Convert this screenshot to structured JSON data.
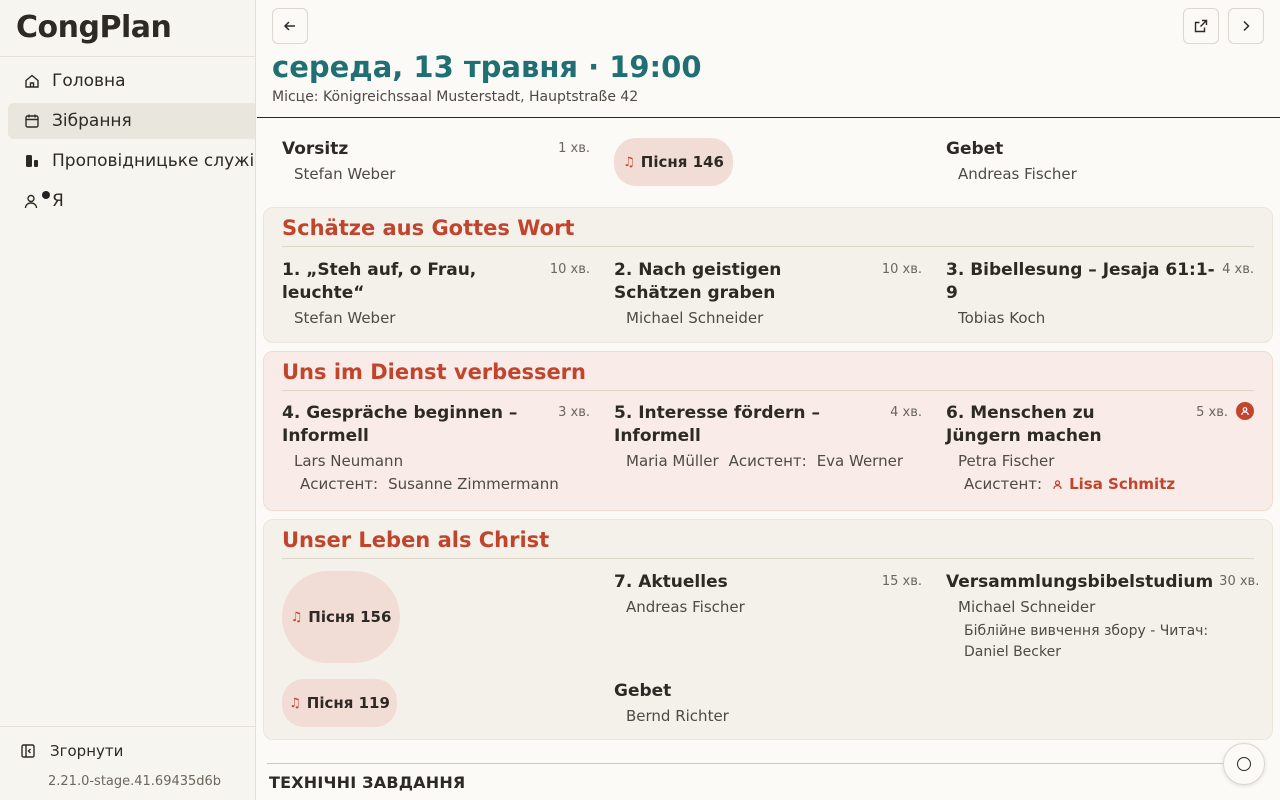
{
  "sidebar": {
    "brand": "CongPlan",
    "items": [
      {
        "label": "Головна",
        "icon": "home-icon"
      },
      {
        "label": "Зібрання",
        "icon": "calendar-icon"
      },
      {
        "label": "Проповідницьке служіння",
        "icon": "ministry-icon"
      },
      {
        "label": "Я",
        "icon": "user-icon"
      }
    ],
    "collapse_label": "Згорнути",
    "version": "2.21.0-stage.41.69435d6b"
  },
  "header": {
    "title": "середа, 13 травня · 19:00",
    "location": "Місце: Königreichssaal Musterstadt, Hauptstraße 42"
  },
  "opening": {
    "chairman": {
      "title": "Vorsitz",
      "duration": "1 хв.",
      "person": "Stefan Weber"
    },
    "song": "Пісня 146",
    "prayer": {
      "title": "Gebet",
      "person": "Andreas Fischer"
    }
  },
  "treasures": {
    "title": "Schätze aus Gottes Wort",
    "parts": [
      {
        "title": "1. „Steh auf, o Frau, leuchte“",
        "duration": "10 хв.",
        "person": "Stefan Weber"
      },
      {
        "title": "2. Nach geistigen Schätzen graben",
        "duration": "10 хв.",
        "person": "Michael Schneider"
      },
      {
        "title": "3. Bibellesung – Jesaja 61:1-9",
        "duration": "4 хв.",
        "person": "Tobias Koch"
      }
    ]
  },
  "ministry": {
    "title": "Uns im Dienst verbessern",
    "assistant_label": "Асистент:",
    "parts": [
      {
        "title": "4. Gespräche beginnen – Informell",
        "duration": "3 хв.",
        "person": "Lars Neumann",
        "assistant": "Susanne Zimmermann"
      },
      {
        "title": "5. Interesse fördern – Informell",
        "duration": "4 хв.",
        "person": "Maria Müller",
        "assistant": "Eva Werner"
      },
      {
        "title": "6. Menschen zu Jüngern machen",
        "duration": "5 хв.",
        "person": "Petra Fischer",
        "assistant": "Lisa Schmitz"
      }
    ]
  },
  "living": {
    "title": "Unser Leben als Christ",
    "song_middle": "Пісня 156",
    "song_closing": "Пісня 119",
    "parts": [
      {
        "title": "7. Aktuelles",
        "duration": "15 хв.",
        "person": "Andreas Fischer"
      },
      {
        "title": "Versammlungsbibelstudium",
        "duration": "30 хв.",
        "person": "Michael Schneider",
        "reader_note": "Біблійне вивчення збору - Читач: Daniel Becker"
      }
    ],
    "closing_prayer": {
      "title": "Gebet",
      "person": "Bernd Richter"
    }
  },
  "tech_heading": "ТЕХНІЧНІ ЗАВДАННЯ",
  "colors": {
    "accent": "#1f6f73",
    "section_title": "#c1442c",
    "song_bg": "#f1ddd5"
  }
}
